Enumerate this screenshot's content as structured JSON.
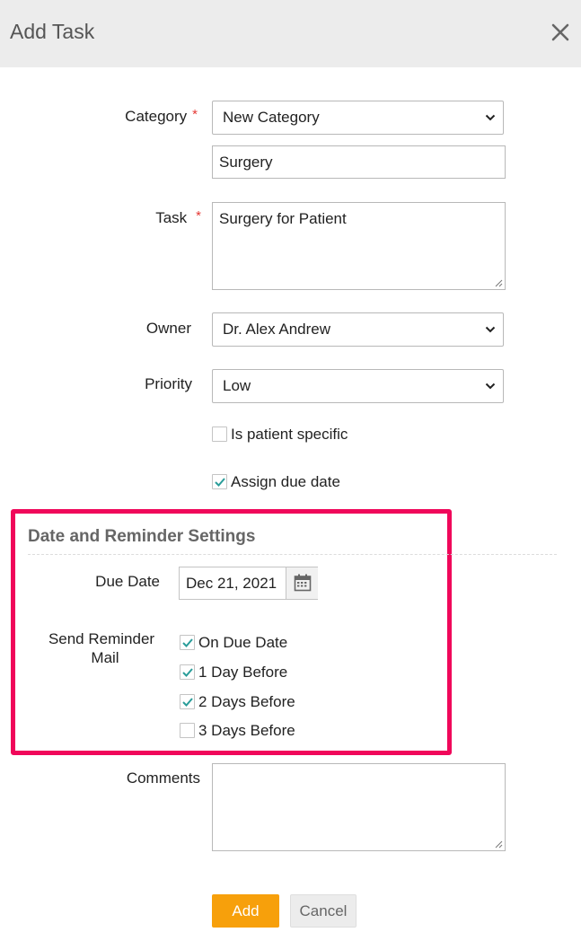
{
  "dialog": {
    "title": "Add Task"
  },
  "form": {
    "category": {
      "label": "Category",
      "required_mark": "*",
      "selected": "New Category",
      "new_value": "Surgery"
    },
    "task": {
      "label": "Task",
      "required_mark": "*",
      "value": "Surgery for Patient"
    },
    "owner": {
      "label": "Owner",
      "selected": "Dr. Alex Andrew"
    },
    "priority": {
      "label": "Priority",
      "selected": "Low"
    },
    "patient_specific": {
      "label": "Is patient specific",
      "checked": false
    },
    "assign_due_date": {
      "label": "Assign due date",
      "checked": true
    }
  },
  "reminder_section": {
    "title": "Date and Reminder Settings",
    "due_date": {
      "label": "Due Date",
      "value": "Dec 21, 2021"
    },
    "send_reminder": {
      "label_line1": "Send Reminder",
      "label_line2": "Mail",
      "options": [
        {
          "label": "On Due Date",
          "checked": true
        },
        {
          "label": "1 Day Before",
          "checked": true
        },
        {
          "label": "2 Days Before",
          "checked": true
        },
        {
          "label": "3 Days Before",
          "checked": false
        }
      ]
    },
    "highlight_color": "#f0075a"
  },
  "comments": {
    "label": "Comments",
    "value": ""
  },
  "actions": {
    "add_label": "Add",
    "cancel_label": "Cancel"
  },
  "colors": {
    "primary": "#f7a00b",
    "check": "#2a9d9a",
    "required": "#e53935"
  }
}
